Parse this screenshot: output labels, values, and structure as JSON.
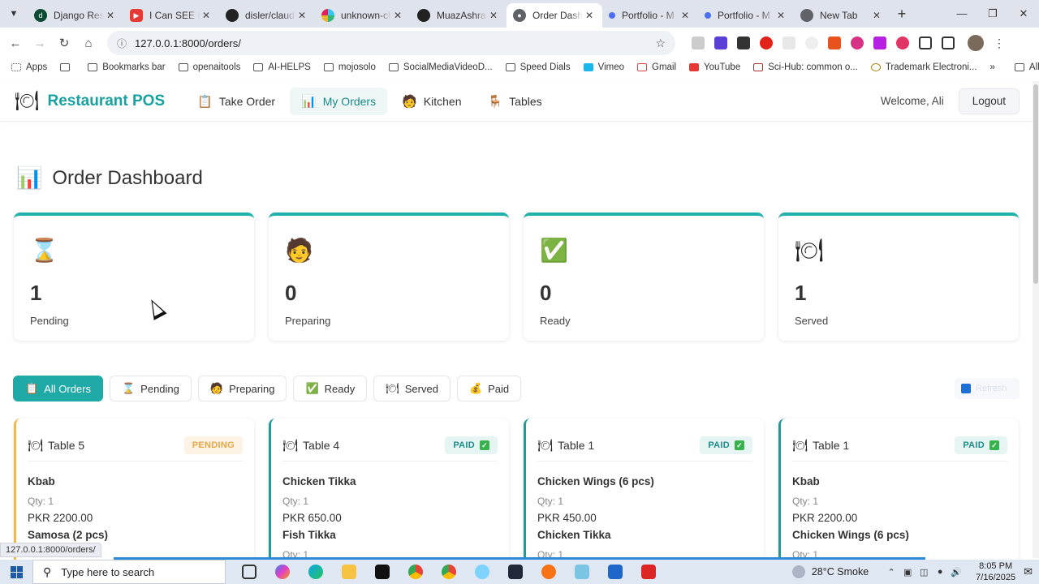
{
  "browser": {
    "tabs": [
      {
        "title": "Django Resta",
        "icon": "django-icon",
        "color": "#0c4b33"
      },
      {
        "title": "I Can SEE EVE",
        "icon": "youtube-icon",
        "color": "#e53935"
      },
      {
        "title": "disler/claude",
        "icon": "github-icon",
        "color": "#222222"
      },
      {
        "title": "unknown-cha",
        "icon": "slack-icon",
        "color": "#4a154b"
      },
      {
        "title": "MuazAshraf /",
        "icon": "github-icon",
        "color": "#222222"
      },
      {
        "title": "Order Dashb",
        "icon": "globe-icon",
        "color": "#5f6368",
        "active": true
      },
      {
        "title": "Portfolio - M",
        "icon": "portfolio-icon",
        "color": "#4c6ef5"
      },
      {
        "title": "Portfolio - M",
        "icon": "portfolio-icon",
        "color": "#4c6ef5"
      },
      {
        "title": "New Tab",
        "icon": "chrome-icon",
        "color": "#5f6368"
      }
    ],
    "url": "127.0.0.1:8000/orders/",
    "bookmarks": [
      {
        "label": "Apps",
        "icon": "apps-grid-icon"
      },
      {
        "label": "",
        "icon": "grid-icon"
      },
      {
        "label": "Bookmarks bar",
        "icon": "folder-icon"
      },
      {
        "label": "openaitools",
        "icon": "folder-icon"
      },
      {
        "label": "AI-HELPS",
        "icon": "folder-icon"
      },
      {
        "label": "mojosolo",
        "icon": "folder-icon"
      },
      {
        "label": "SocialMediaVideoD...",
        "icon": "folder-icon"
      },
      {
        "label": "Speed Dials",
        "icon": "folder-icon"
      },
      {
        "label": "Vimeo",
        "icon": "vimeo-icon"
      },
      {
        "label": "Gmail",
        "icon": "gmail-icon"
      },
      {
        "label": "YouTube",
        "icon": "youtube-icon"
      },
      {
        "label": "Sci-Hub: common o...",
        "icon": "scihub-icon"
      },
      {
        "label": "Trademark Electroni...",
        "icon": "trademark-icon"
      }
    ],
    "all_bookmarks": "All Bookmarks",
    "status_url": "127.0.0.1:8000/orders/"
  },
  "app": {
    "brand": "Restaurant POS",
    "nav": [
      {
        "label": "Take Order",
        "icon": "clipboard-icon"
      },
      {
        "label": "My Orders",
        "icon": "chart-icon",
        "active": true
      },
      {
        "label": "Kitchen",
        "icon": "chef-icon"
      },
      {
        "label": "Tables",
        "icon": "table-icon"
      }
    ],
    "welcome": "Welcome, Ali",
    "logout": "Logout",
    "page_title": "Order Dashboard",
    "stats": [
      {
        "value": "1",
        "label": "Pending",
        "icon": "hourglass-icon"
      },
      {
        "value": "0",
        "label": "Preparing",
        "icon": "cook-icon"
      },
      {
        "value": "0",
        "label": "Ready",
        "icon": "checkmark-icon"
      },
      {
        "value": "1",
        "label": "Served",
        "icon": "plate-icon"
      }
    ],
    "filters": [
      {
        "label": "All Orders",
        "icon": "clipboard-icon",
        "active": true
      },
      {
        "label": "Pending",
        "icon": "hourglass-icon"
      },
      {
        "label": "Preparing",
        "icon": "cook-icon"
      },
      {
        "label": "Ready",
        "icon": "checkmark-icon"
      },
      {
        "label": "Served",
        "icon": "plate-icon"
      },
      {
        "label": "Paid",
        "icon": "money-bag-icon"
      }
    ],
    "refresh_label": "Refresh",
    "orders": [
      {
        "table": "Table 5",
        "status": "PENDING",
        "status_type": "pending",
        "items": [
          {
            "name": "Kbab",
            "qty": "Qty: 1",
            "price": "PKR 2200.00"
          },
          {
            "name": "Samosa (2 pcs)"
          }
        ]
      },
      {
        "table": "Table 4",
        "status": "PAID",
        "status_type": "paid",
        "items": [
          {
            "name": "Chicken Tikka",
            "qty": "Qty: 1",
            "price": "PKR 650.00"
          },
          {
            "name": "Fish Tikka",
            "qty": "Qty: 1"
          }
        ]
      },
      {
        "table": "Table 1",
        "status": "PAID",
        "status_type": "paid",
        "items": [
          {
            "name": "Chicken Wings (6 pcs)",
            "qty": "Qty: 1",
            "price": "PKR 450.00"
          },
          {
            "name": "Chicken Tikka",
            "qty": "Qty: 1"
          }
        ]
      },
      {
        "table": "Table 1",
        "status": "PAID",
        "status_type": "paid",
        "items": [
          {
            "name": "Kbab",
            "qty": "Qty: 1",
            "price": "PKR 2200.00"
          },
          {
            "name": "Chicken Wings (6 pcs)",
            "qty": "Qty: 1"
          }
        ]
      }
    ]
  },
  "taskbar": {
    "search_placeholder": "Type here to search",
    "weather": "28°C  Smoke",
    "time": "8:05 PM",
    "date": "7/16/2025"
  },
  "colors": {
    "accent": "#20b2aa",
    "pending": "#f4b942",
    "paid": "#1a8d8a"
  }
}
